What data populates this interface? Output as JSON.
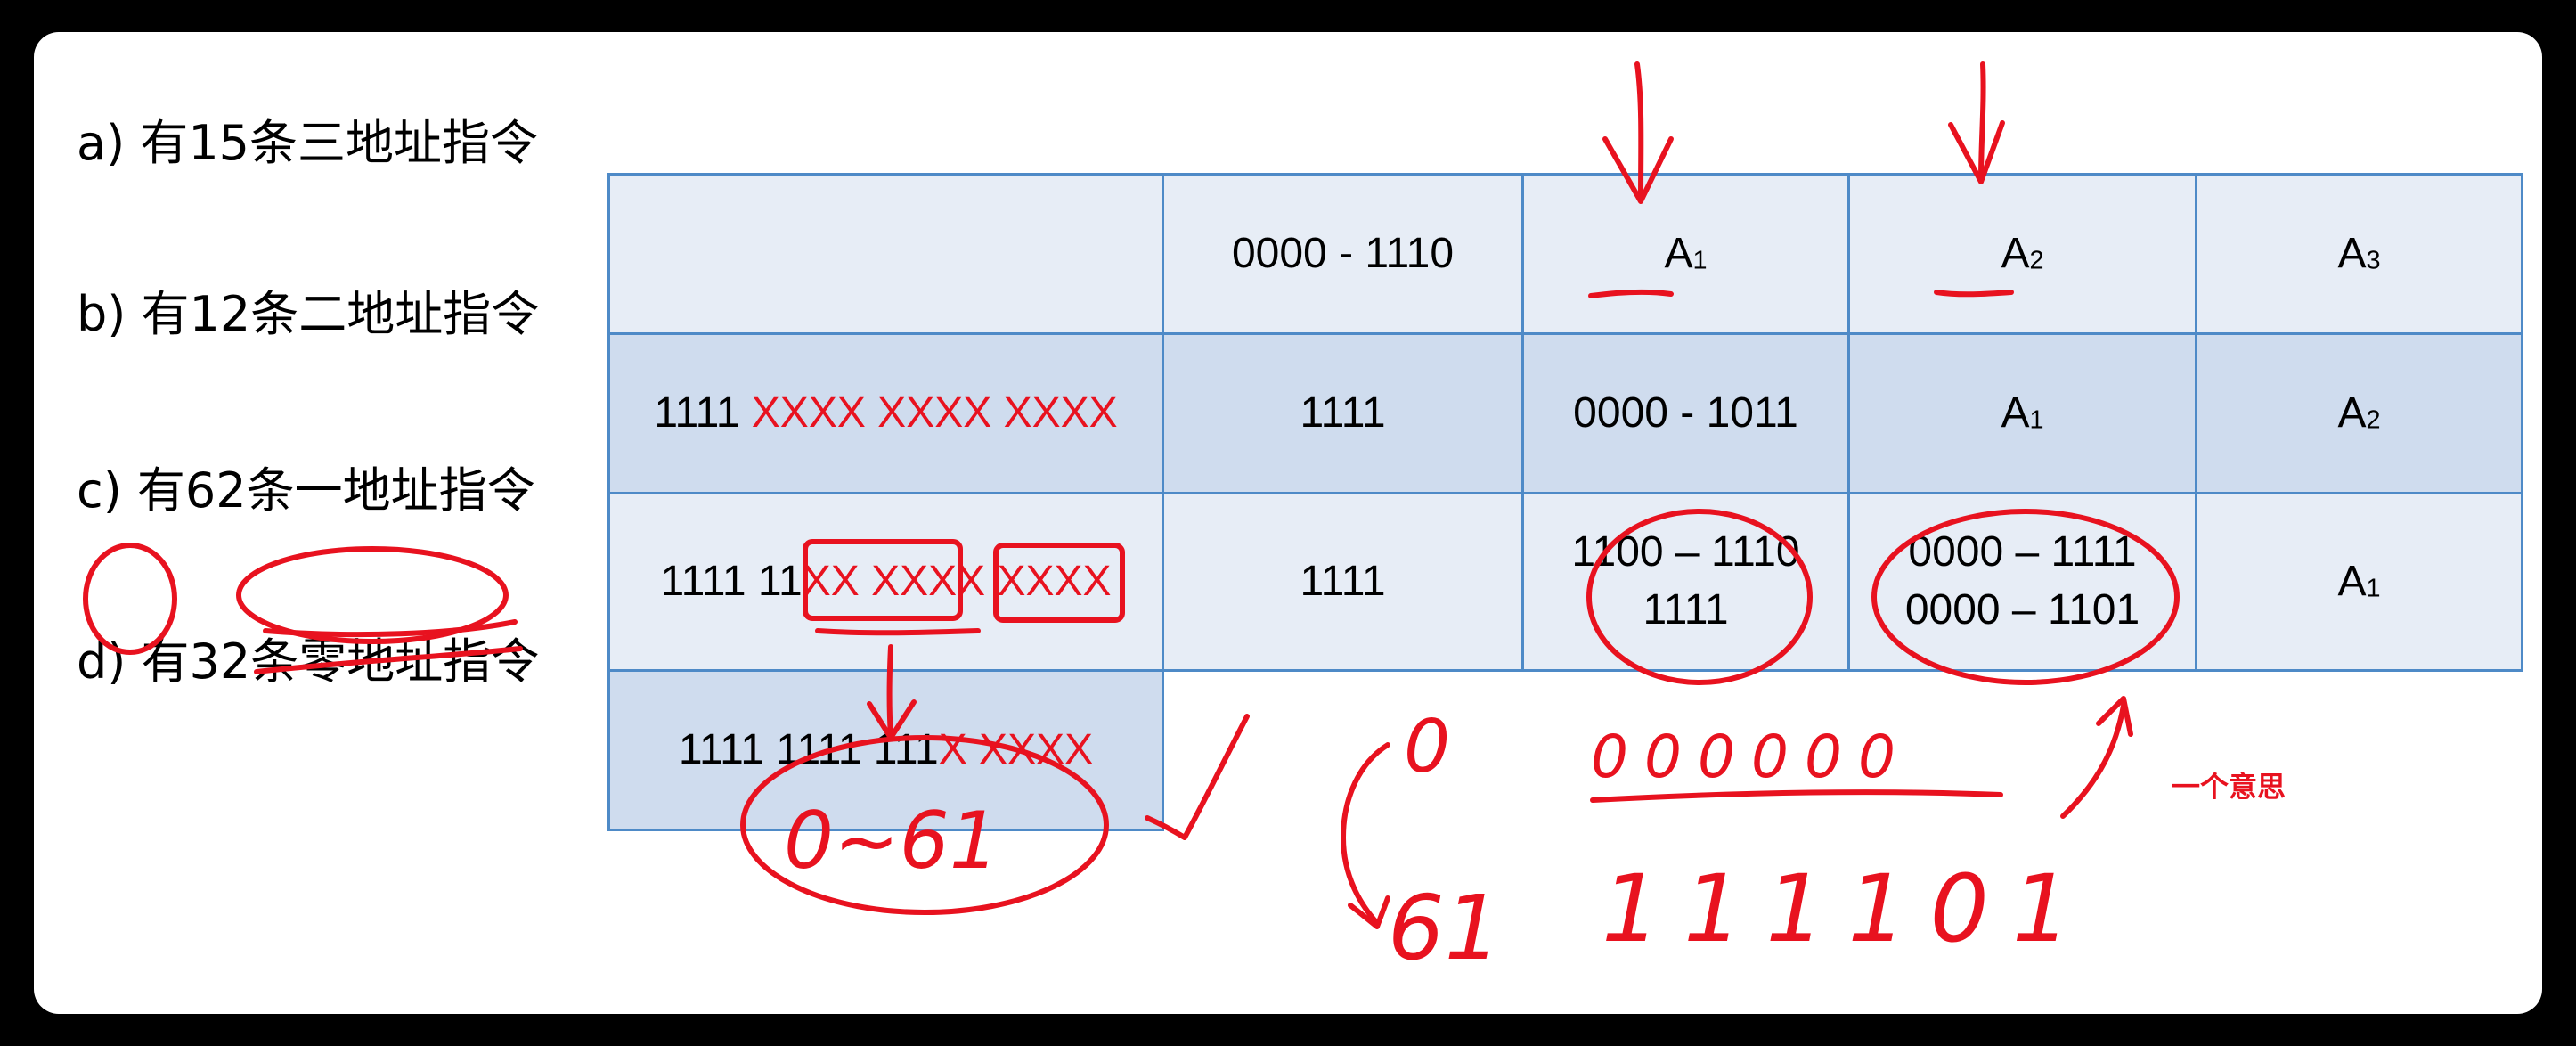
{
  "labels": {
    "a": "a) 有15条三地址指令",
    "b": "b) 有12条二地址指令",
    "c": "c) 有62条一地址指令",
    "d": "d) 有32条零地址指令"
  },
  "table": {
    "row_a": {
      "c2": "0000 - 1110",
      "c3": "A",
      "c3_sub": "1",
      "c4": "A",
      "c4_sub": "2",
      "c5": "A",
      "c5_sub": "3"
    },
    "row_b": {
      "c1_black": "1111 ",
      "c1_red": "XXXX XXXX XXXX",
      "c2": "1111",
      "c3": "0000 - 1011",
      "c4": "A",
      "c4_sub": "1",
      "c5": "A",
      "c5_sub": "2"
    },
    "row_c": {
      "c1_black": "1111 11",
      "c1_red": "XX XXXX XXXX",
      "c2": "1111",
      "c3_line1": "1100 – 1110",
      "c3_line2": "1111",
      "c4_line1": "0000 – 1111",
      "c4_line2": "0000 – 1101",
      "c5": "A",
      "c5_sub": "1"
    },
    "row_d": {
      "c1_black": "1111 1111 111",
      "c1_red": "X XXXX"
    }
  },
  "handwriting": {
    "range": "0~61",
    "zero": "0",
    "zeros": "000000",
    "sixty_one": "61",
    "binary": "111101",
    "note": "一个意思"
  }
}
